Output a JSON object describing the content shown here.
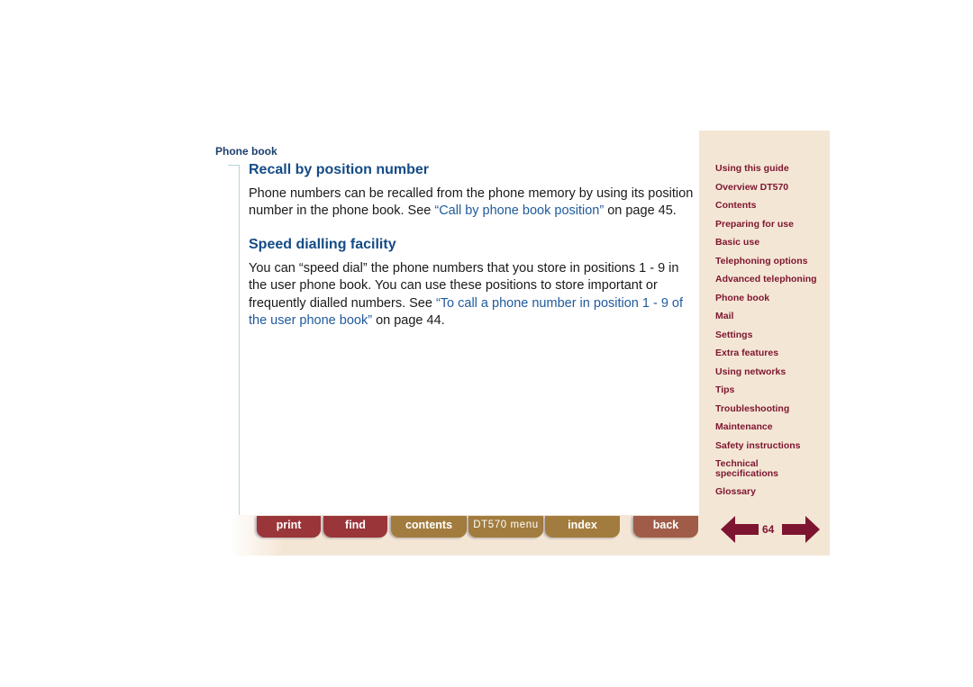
{
  "section_label": "Phone book",
  "sections": [
    {
      "heading": "Recall by position number",
      "text_before": "Phone numbers can be recalled from the phone memory by using its position number in the phone book. See ",
      "link": "“Call by phone book position”",
      "text_after": " on page 45."
    },
    {
      "heading": "Speed dialling facility",
      "text_before": "You can “speed dial” the phone numbers that you store in positions 1 - 9 in the user phone book. You can use these positions to store important or frequently dialled numbers. See ",
      "link": "“To call a phone number in position 1 - 9 of the user phone book”",
      "text_after": " on page 44."
    }
  ],
  "nav": {
    "items": [
      "Using this guide",
      "Overview DT570",
      "Contents",
      "Preparing for use",
      "Basic use",
      "Telephoning options",
      "Advanced telephoning",
      "Phone book",
      "Mail",
      "Settings",
      "Extra features",
      "Using networks",
      "Tips",
      "Troubleshooting",
      "Maintenance",
      "Safety instructions",
      "Technical specifications",
      "Glossary"
    ]
  },
  "toolbar": {
    "print": "print",
    "find": "find",
    "contents": "contents",
    "menu": "DT570 menu",
    "index": "index",
    "back": "back"
  },
  "page_number": "64",
  "colors": {
    "heading": "#144b86",
    "link": "#1f5a9c",
    "nav_text": "#7d1530",
    "panel_bg": "#f4e6d5",
    "tab_red": "#9a353a",
    "tab_gold": "#a27c3e",
    "tab_back": "#a05c48"
  }
}
